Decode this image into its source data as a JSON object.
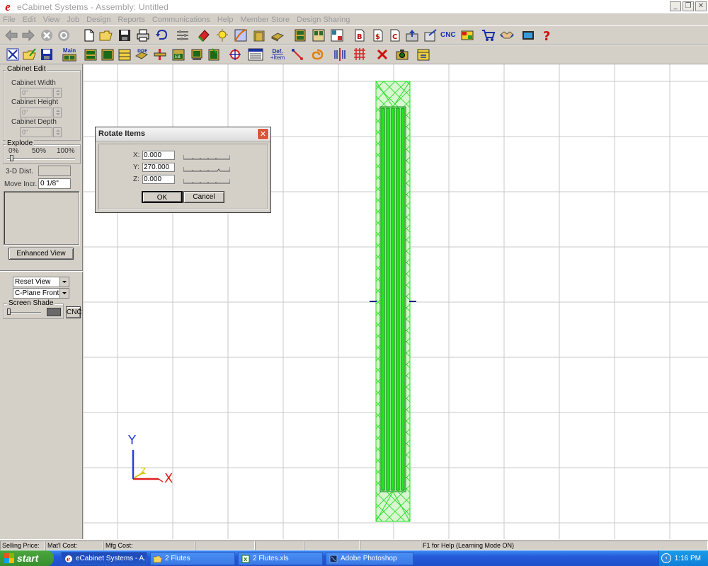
{
  "window": {
    "title": "eCabinet Systems - Assembly: Untitled",
    "logo_letter": "e",
    "minimize": "_",
    "restore": "❐",
    "close": "✕"
  },
  "menu": [
    "File",
    "Edit",
    "View",
    "Job",
    "Design",
    "Reports",
    "Communications",
    "Help",
    "Member Store",
    "Design Sharing"
  ],
  "toolbar_text": {
    "cnc": "CNC",
    "main": "Main",
    "def_item": "Def.",
    "def_item2": "+Item"
  },
  "left_panel": {
    "cabinet_edit_title": "Cabinet Edit",
    "cabinet_width_label": "Cabinet Width",
    "cabinet_width_value": "0\"",
    "cabinet_height_label": "Cabinet Height",
    "cabinet_height_value": "0\"",
    "cabinet_depth_label": "Cabinet Depth",
    "cabinet_depth_value": "0\"",
    "explode_title": "Explode",
    "explode_0": "0%",
    "explode_50": "50%",
    "explode_100": "100%",
    "dist3d_label": "3-D Dist.",
    "dist3d_value": "",
    "move_incr_label": "Move Incr.",
    "move_incr_value": "0 1/8\"",
    "enhanced_view_label": "Enhanced View",
    "reset_view_value": "Reset View",
    "cplane_value": "C-Plane Front",
    "screen_shade_title": "Screen Shade",
    "cnc_button_label": "CNC"
  },
  "axis_indicator": {
    "y_label": "Y",
    "x_label": "X",
    "z_label": "Z",
    "y_color": "#2a3fd6",
    "x_color": "#e02020",
    "z_color": "#d8c800"
  },
  "rotate_dialog": {
    "title": "Rotate Items",
    "close_glyph": "✕",
    "x_label": "X:",
    "x_value": "0.000",
    "y_label": "Y:",
    "y_value": "270.000",
    "z_label": "Z:",
    "z_value": "0.000",
    "x_slider_fraction": 0.5,
    "y_slider_fraction": 0.75,
    "z_slider_fraction": 0.5,
    "ok_label": "OK",
    "cancel_label": "Cancel"
  },
  "status_bar": {
    "selling_price": "Selling Price:",
    "matl_cost": "Mat'l Cost:",
    "mfg_cost": "Mfg Cost:",
    "help_text": "F1 for Help (Learning Mode ON)"
  },
  "taskbar": {
    "start_label": "start",
    "tasks": [
      "eCabinet Systems - A...",
      "2 Flutes",
      "2 Flutes.xls",
      "Adobe Photoshop"
    ],
    "clock": "1:16 PM",
    "tray_chevron": "‹"
  },
  "colors": {
    "part_green": "#22dd22",
    "part_fill": "#ccf5cc",
    "grid": "#c8c8c8"
  }
}
